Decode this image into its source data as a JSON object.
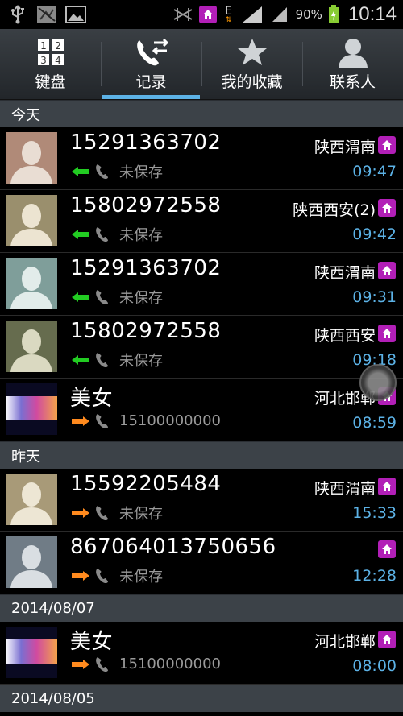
{
  "status_bar": {
    "network_type": "E",
    "battery_percent": "90%",
    "time": "10:14"
  },
  "tabs": [
    {
      "label": "键盘",
      "icon": "dialpad-icon",
      "active": false
    },
    {
      "label": "记录",
      "icon": "call-log-icon",
      "active": true
    },
    {
      "label": "我的收藏",
      "icon": "star-icon",
      "active": false
    },
    {
      "label": "联系人",
      "icon": "person-icon",
      "active": false
    }
  ],
  "sections": [
    {
      "header": "今天",
      "rows": [
        {
          "name": "15291363702",
          "direction": "incoming",
          "detail": "未保存",
          "location": "陕西渭南",
          "time": "09:47",
          "avatar": "silhouette-brown"
        },
        {
          "name": "15802972558",
          "direction": "incoming",
          "detail": "未保存",
          "location": "陕西西安(2)",
          "time": "09:42",
          "avatar": "silhouette-olive"
        },
        {
          "name": "15291363702",
          "direction": "incoming",
          "detail": "未保存",
          "location": "陕西渭南",
          "time": "09:31",
          "avatar": "silhouette-teal"
        },
        {
          "name": "15802972558",
          "direction": "incoming",
          "detail": "未保存",
          "location": "陕西西安",
          "time": "09:18",
          "avatar": "silhouette-green"
        },
        {
          "name": "美女",
          "direction": "outgoing",
          "detail": "15100000000",
          "location": "河北邯郸",
          "time": "08:59",
          "avatar": "photo-gradient"
        }
      ]
    },
    {
      "header": "昨天",
      "rows": [
        {
          "name": "15592205484",
          "direction": "outgoing",
          "detail": "未保存",
          "location": "陕西渭南",
          "time": "15:33",
          "avatar": "silhouette-tan"
        },
        {
          "name": "867064013750656",
          "direction": "outgoing",
          "detail": "未保存",
          "location": "",
          "time": "12:28",
          "avatar": "silhouette-slate"
        }
      ]
    },
    {
      "header": "2014/08/07",
      "rows": [
        {
          "name": "美女",
          "direction": "outgoing",
          "detail": "15100000000",
          "location": "河北邯郸",
          "time": "08:00",
          "avatar": "photo-gradient"
        }
      ]
    },
    {
      "header": "2014/08/05",
      "rows": []
    }
  ],
  "colors": {
    "accent": "#5cb2e6",
    "incoming_arrow": "#22cc22",
    "outgoing_arrow": "#ff8a1e",
    "home_badge": "#b21fb7"
  }
}
